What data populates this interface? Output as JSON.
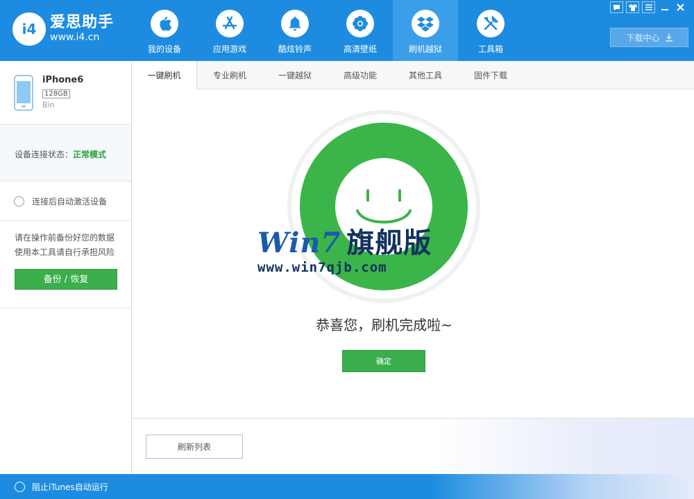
{
  "header": {
    "logo_mark": "i4",
    "app_name": "爱思助手",
    "app_url": "www.i4.cn",
    "nav": [
      {
        "label": "我的设备",
        "icon": "apple-icon"
      },
      {
        "label": "应用游戏",
        "icon": "app-store-icon"
      },
      {
        "label": "酷炫铃声",
        "icon": "bell-icon"
      },
      {
        "label": "高清壁纸",
        "icon": "flower-icon"
      },
      {
        "label": "刷机越狱",
        "icon": "dropbox-icon",
        "active": true
      },
      {
        "label": "工具箱",
        "icon": "tools-icon"
      }
    ],
    "download_center": "下载中心"
  },
  "window_controls": [
    {
      "name": "feedback-icon",
      "glyph": "▬"
    },
    {
      "name": "skin-icon",
      "glyph": "👕"
    },
    {
      "name": "menu-icon",
      "glyph": "≡"
    },
    {
      "name": "minimize-icon",
      "glyph": "—"
    },
    {
      "name": "close-icon",
      "glyph": "✕"
    }
  ],
  "sidebar": {
    "device": {
      "name": "iPhone6",
      "capacity": "128GB",
      "sub": "Bin"
    },
    "status_label": "设备连接状态：",
    "status_value": "正常模式",
    "auto_activate": "连接后自动激活设备",
    "tip_line1": "请在操作前备份好您的数据",
    "tip_line2": "使用本工具请自行承担风险",
    "backup_button": "备份 / 恢复"
  },
  "tabs": [
    "一键刷机",
    "专业刷机",
    "一键越狱",
    "高级功能",
    "其他工具",
    "固件下载"
  ],
  "main": {
    "message": "恭喜您，刷机完成啦~",
    "confirm_button": "确定",
    "refresh_button": "刷新列表"
  },
  "watermark": {
    "brand": "Win7",
    "brand_cn": "旗舰版",
    "url": "www.win7qjb.com"
  },
  "footer": {
    "itunes_toggle": "阻止iTunes自动运行"
  },
  "colors": {
    "header_blue": "#1d8ce0",
    "success_green": "#3bb54a",
    "status_green": "#2e9e3f"
  }
}
